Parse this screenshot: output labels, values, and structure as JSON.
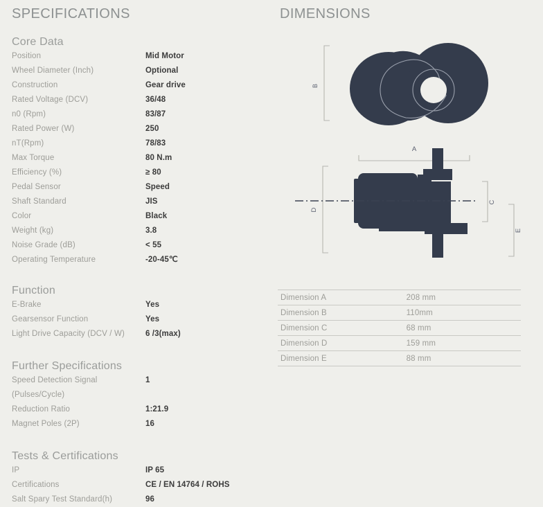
{
  "left": {
    "heading": "SPECIFICATIONS",
    "sections": [
      {
        "title": "Core Data",
        "rows": [
          {
            "label": "Position",
            "value": "Mid Motor"
          },
          {
            "label": "Wheel Diameter (Inch)",
            "value": "Optional"
          },
          {
            "label": "Construction",
            "value": "Gear drive"
          },
          {
            "label": "Rated Voltage (DCV)",
            "value": "36/48"
          },
          {
            "label": "n0 (Rpm)",
            "value": "83/87"
          },
          {
            "label": "Rated Power (W)",
            "value": "250"
          },
          {
            "label": "nT(Rpm)",
            "value": "78/83"
          },
          {
            "label": "Max Torque",
            "value": "80 N.m"
          },
          {
            "label": "Efficiency (%)",
            "value": "≥ 80"
          },
          {
            "label": "Pedal Sensor",
            "value": "Speed"
          },
          {
            "label": "Shaft Standard",
            "value": "JIS"
          },
          {
            "label": "Color",
            "value": "Black"
          },
          {
            "label": "Weight (kg)",
            "value": "3.8"
          },
          {
            "label": "Noise Grade (dB)",
            "value": "< 55"
          },
          {
            "label": "Operating Temperature",
            "value": "-20-45℃"
          }
        ]
      },
      {
        "title": "Function",
        "rows": [
          {
            "label": "E-Brake",
            "value": "Yes"
          },
          {
            "label": "Gearsensor Function",
            "value": "Yes"
          },
          {
            "label": "Light Drive Capacity (DCV / W)",
            "value": "6 /3(max)"
          }
        ]
      },
      {
        "title": "Further Specifications",
        "rows": [
          {
            "label": "Speed Detection Signal",
            "label2": "(Pulses/Cycle)",
            "value": "1"
          },
          {
            "label": "Reduction Ratio",
            "value": "1:21.9"
          },
          {
            "label": "Magnet Poles (2P)",
            "value": "16"
          }
        ]
      },
      {
        "title": "Tests & Certifications",
        "rows": [
          {
            "label": "IP",
            "value": "IP 65"
          },
          {
            "label": "Certifications",
            "value": "CE / EN 14764 / ROHS"
          },
          {
            "label": "Salt Spary Test Standard(h)",
            "value": "96"
          }
        ]
      }
    ]
  },
  "right": {
    "heading": "DIMENSIONS",
    "diagram_top": {
      "callouts": [
        {
          "label": "B"
        }
      ]
    },
    "diagram_bottom": {
      "callouts": [
        {
          "label": "A"
        },
        {
          "label": "C"
        },
        {
          "label": "D"
        },
        {
          "label": "E"
        }
      ]
    },
    "dimension_table": {
      "rows": [
        {
          "name": "Dimension A",
          "value": "208 mm"
        },
        {
          "name": "Dimension B",
          "value": "110mm"
        },
        {
          "name": "Dimension C",
          "value": "68 mm"
        },
        {
          "name": "Dimension D",
          "value": "159 mm"
        },
        {
          "name": "Dimension E",
          "value": "88 mm"
        }
      ]
    }
  },
  "colors": {
    "background": "#efefeb",
    "part_dark": "#343c4c",
    "heading": "#8d9191",
    "label": "#9d9d98",
    "value": "#3b3b3b",
    "rule": "#c9c9c4",
    "callout": "#b6b6b0"
  }
}
